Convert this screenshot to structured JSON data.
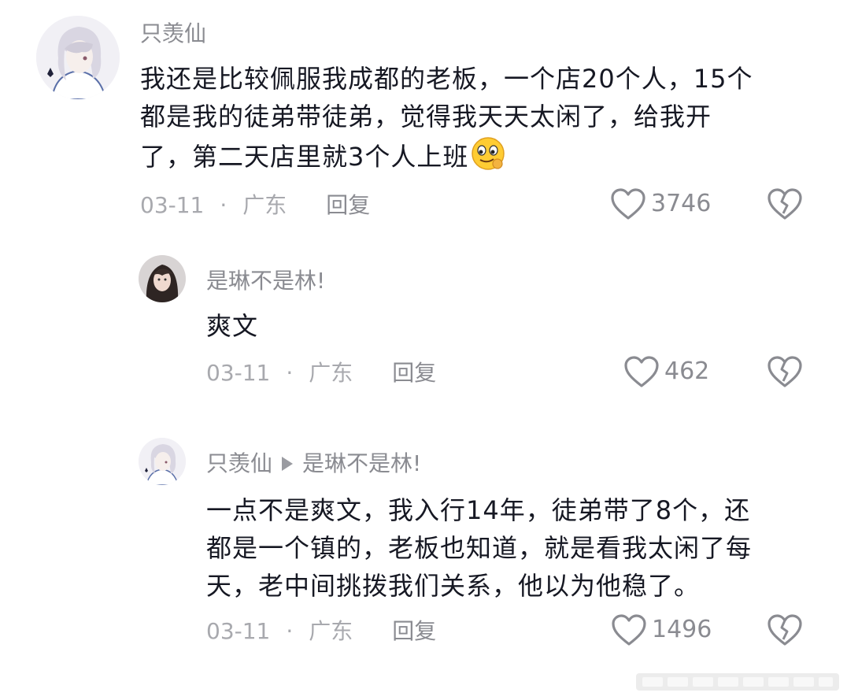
{
  "comments": [
    {
      "username": "只羡仙",
      "lines": [
        "我还是比较佩服我成都的老板，一个店20个人，15个",
        "都是我的徒弟带徒弟，觉得我天天太闲了，给我开",
        "了，第二天店里就3个人上班"
      ],
      "emoji": "smirk-emoji",
      "date": "03-11",
      "sep": "·",
      "location": "广东",
      "reply_label": "回复",
      "likes": "3746"
    },
    {
      "username": "是琳不是林!",
      "lines": [
        "爽文"
      ],
      "date": "03-11",
      "sep": "·",
      "location": "广东",
      "reply_label": "回复",
      "likes": "462"
    },
    {
      "username": "只羡仙",
      "reply_to": "是琳不是林!",
      "lines": [
        "一点不是爽文，我入行14年，徒弟带了8个，还",
        "都是一个镇的，老板也知道，就是看我太闲了每",
        "天，老中间挑拨我们关系，他以为他稳了。"
      ],
      "date": "03-11",
      "sep": "·",
      "location": "广东",
      "reply_label": "回复",
      "likes": "1496"
    }
  ],
  "icons": {
    "like": "heart-icon",
    "dislike": "broken-heart-icon",
    "reply_arrow": "triangle-right-icon"
  },
  "colors": {
    "text": "#161823",
    "muted": "#8a8b91",
    "meta": "#a8a9ae"
  }
}
